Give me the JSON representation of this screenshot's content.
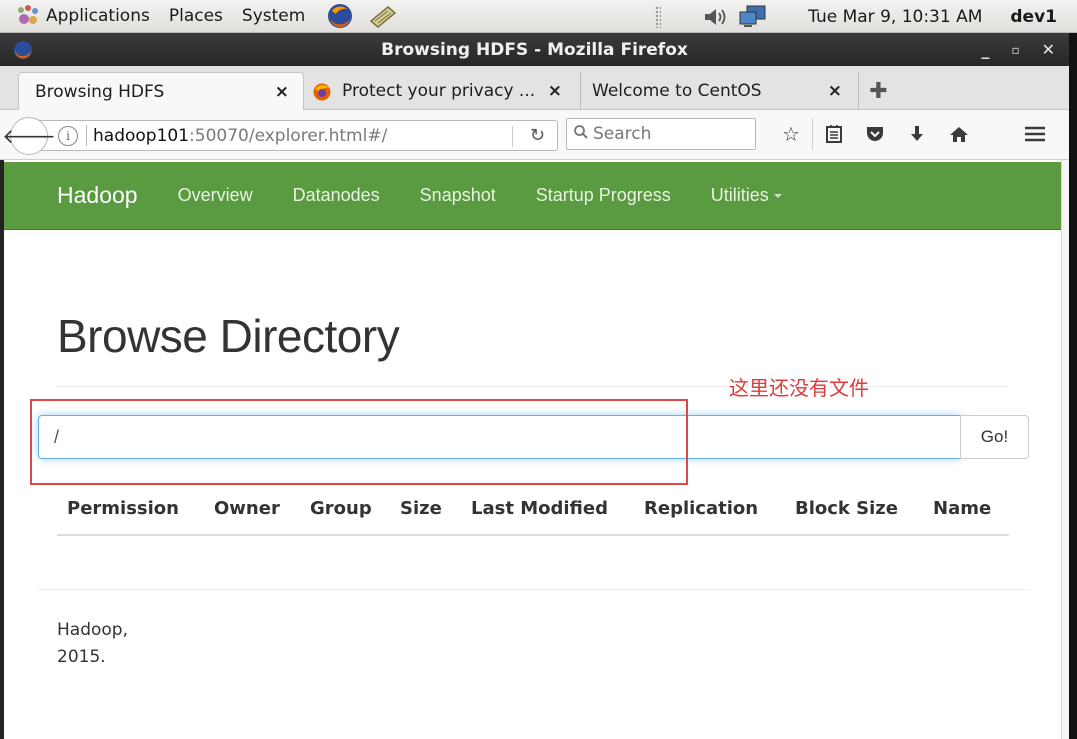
{
  "panel": {
    "applications": "Applications",
    "places": "Places",
    "system": "System",
    "clock": "Tue Mar  9, 10:31 AM",
    "user": "dev1"
  },
  "window": {
    "title": "Browsing HDFS - Mozilla Firefox"
  },
  "tabs": [
    {
      "label": "Browsing HDFS"
    },
    {
      "label": "Protect your privacy ..."
    },
    {
      "label": "Welcome to CentOS"
    }
  ],
  "nav": {
    "url_host": "hadoop101",
    "url_rest": ":50070/explorer.html#/",
    "search_placeholder": "Search"
  },
  "hadoop_nav": {
    "brand": "Hadoop",
    "links": [
      "Overview",
      "Datanodes",
      "Snapshot",
      "Startup Progress",
      "Utilities"
    ]
  },
  "page": {
    "title": "Browse Directory",
    "annotation": "这里还没有文件",
    "dir_value": "/",
    "go_label": "Go!",
    "columns": [
      "Permission",
      "Owner",
      "Group",
      "Size",
      "Last Modified",
      "Replication",
      "Block Size",
      "Name"
    ],
    "footer_line1": "Hadoop,",
    "footer_line2": "2015."
  },
  "colors": {
    "hadoop_green": "#5a9a40",
    "annotation_red": "#e03a3a"
  }
}
